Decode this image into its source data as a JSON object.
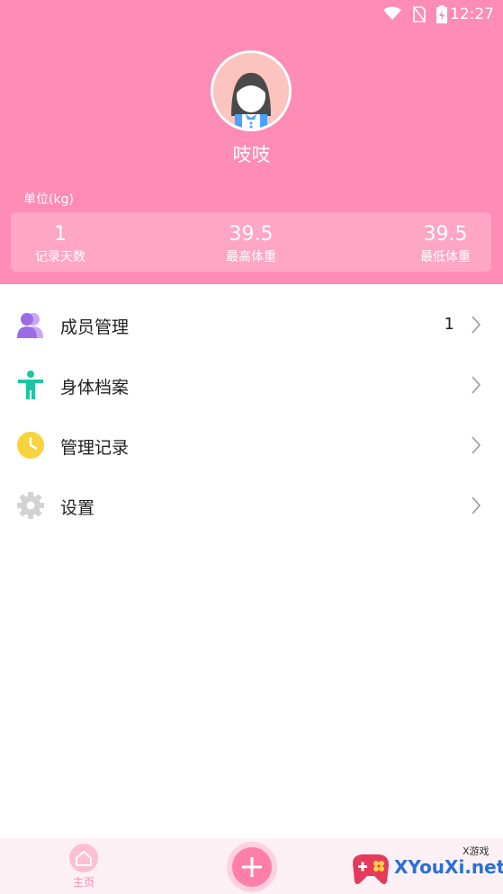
{
  "status_bar": {
    "time": "12:27"
  },
  "profile": {
    "nickname": "吱吱"
  },
  "unit_label": "单位(kg)",
  "stats": [
    {
      "value": "1",
      "label": "记录天数"
    },
    {
      "value": "39.5",
      "label": "最高体重"
    },
    {
      "value": "39.5",
      "label": "最低体重"
    }
  ],
  "menu": {
    "members": {
      "label": "成员管理",
      "count": "1"
    },
    "body_profile": {
      "label": "身体档案"
    },
    "records": {
      "label": "管理记录"
    },
    "settings": {
      "label": "设置"
    }
  },
  "tabbar": {
    "home_label": "主页"
  },
  "watermark": {
    "text": "XYouXi.net",
    "small": "X游戏"
  },
  "colors": {
    "accent": "#ff8cb4",
    "stats_bg": "#ffa6c5",
    "tabbar_bg": "#fdf1f5"
  }
}
